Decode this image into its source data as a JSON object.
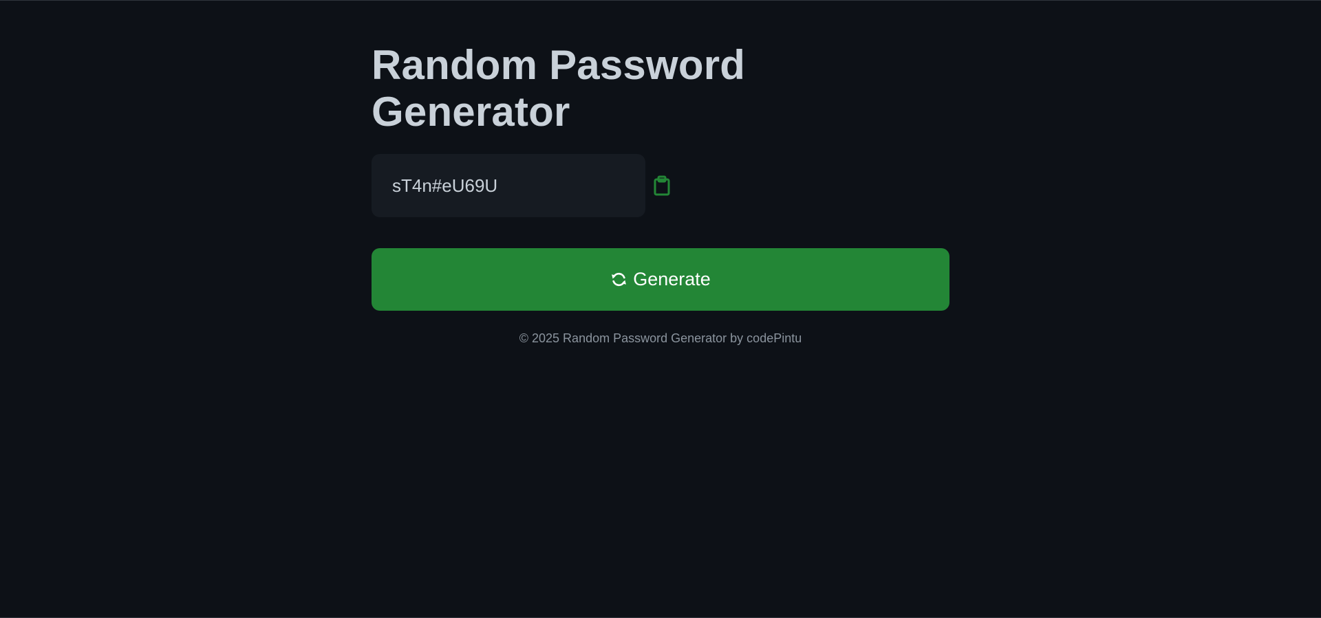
{
  "app": {
    "title": "Random Password Generator"
  },
  "password": {
    "value": "sT4n#eU69U"
  },
  "copy_button": {
    "icon": "clipboard-icon",
    "color": "#238636"
  },
  "generate_button": {
    "label": "Generate",
    "icon": "refresh-icon",
    "color": "#238636"
  },
  "footer": {
    "text": "© 2025 Random Password Generator by codePintu"
  },
  "colors": {
    "background": "#0d1117",
    "field_background": "#161b22",
    "text": "#c9d1d9",
    "muted_text": "#8b949e"
  }
}
